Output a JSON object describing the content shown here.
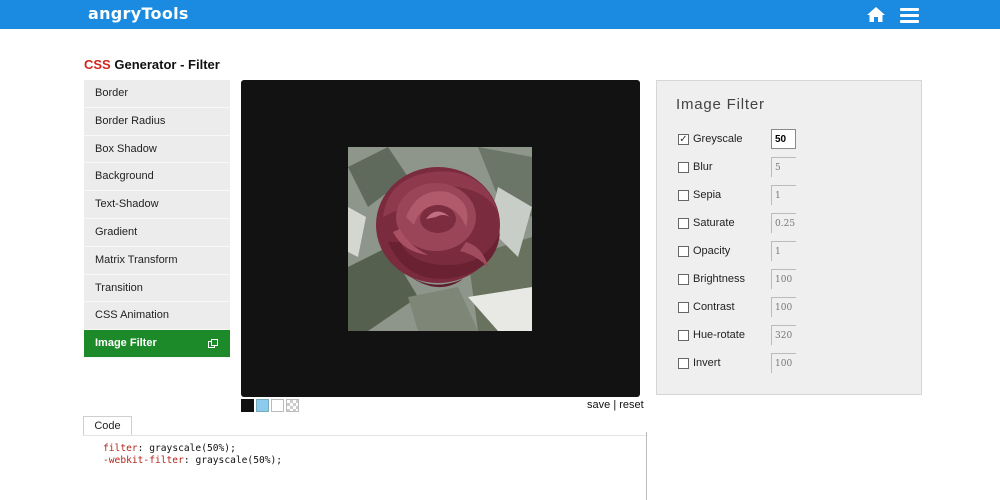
{
  "header": {
    "brand": "angryTools",
    "color": "#1a8be0"
  },
  "title": {
    "accent": "CSS",
    "rest": " Generator - Filter"
  },
  "sidebar": {
    "items": [
      {
        "label": "Border"
      },
      {
        "label": "Border Radius"
      },
      {
        "label": "Box Shadow"
      },
      {
        "label": "Background"
      },
      {
        "label": "Text-Shadow"
      },
      {
        "label": "Gradient"
      },
      {
        "label": "Matrix Transform"
      },
      {
        "label": "Transition"
      },
      {
        "label": "CSS Animation"
      },
      {
        "label": "Image Filter",
        "active": true,
        "icon": "popout-icon"
      }
    ],
    "active_color": "#1d8a2a"
  },
  "preview": {
    "background": "#121212",
    "image": "rose-photo",
    "actions": {
      "save": "save",
      "separator": "|",
      "reset": "reset"
    },
    "swatches": [
      "black",
      "light-blue",
      "white",
      "transparent"
    ]
  },
  "filter_panel": {
    "title": "Image Filter",
    "filters": [
      {
        "label": "Greyscale",
        "checked": true,
        "value": "50"
      },
      {
        "label": "Blur",
        "checked": false,
        "value": "5"
      },
      {
        "label": "Sepia",
        "checked": false,
        "value": "1"
      },
      {
        "label": "Saturate",
        "checked": false,
        "value": "0.25"
      },
      {
        "label": "Opacity",
        "checked": false,
        "value": "1"
      },
      {
        "label": "Brightness",
        "checked": false,
        "value": "100"
      },
      {
        "label": "Contrast",
        "checked": false,
        "value": "100"
      },
      {
        "label": "Hue-rotate",
        "checked": false,
        "value": "320"
      },
      {
        "label": "Invert",
        "checked": false,
        "value": "100"
      }
    ]
  },
  "code": {
    "tab_label": "Code",
    "lines": [
      {
        "prop": "filter",
        "value": "grayscale(50%);"
      },
      {
        "prop": "-webkit-filter",
        "value": "grayscale(50%);"
      }
    ]
  }
}
